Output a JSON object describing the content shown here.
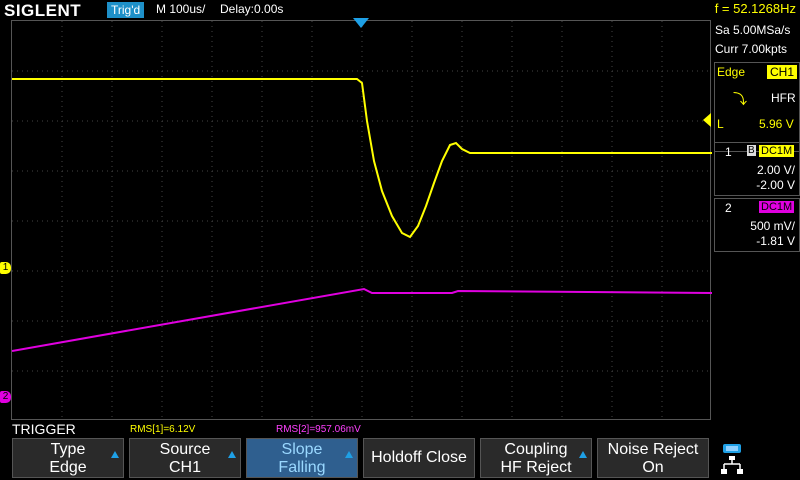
{
  "header": {
    "logo": "SIGLENT",
    "trigger_status": "Trig'd",
    "timebase": "M 100us/",
    "delay": "Delay:0.00s",
    "frequency": "f = 52.1268Hz"
  },
  "panel": {
    "sample_rate": "Sa 5.00MSa/s",
    "memory": "Curr 7.00kpts",
    "trigger": {
      "type": "Edge",
      "source": "CH1",
      "coupling": "HFR",
      "level_label": "L",
      "level": "5.96 V"
    },
    "ch1": {
      "number": "1",
      "coupling_tag": "DC1M",
      "bw": "B",
      "scale": "2.00 V/",
      "offset": "-2.00 V"
    },
    "ch2": {
      "number": "2",
      "coupling_tag": "DC1M",
      "scale": "500 mV/",
      "offset": "-1.81 V"
    }
  },
  "markers": {
    "ch1": "1",
    "ch2": "2"
  },
  "bottom": {
    "menu_title": "TRIGGER",
    "rms1": "RMS[1]=6.12V",
    "rms2": "RMS[2]=957.06mV",
    "softkeys": [
      {
        "l1": "Type",
        "l2": "Edge"
      },
      {
        "l1": "Source",
        "l2": "CH1"
      },
      {
        "l1": "Slope",
        "l2": "Falling"
      },
      {
        "l1": "Holdoff Close"
      },
      {
        "l1": "Coupling",
        "l2": "HF Reject"
      },
      {
        "l1": "Noise Reject",
        "l2": "On"
      }
    ]
  },
  "colors": {
    "ch1": "#ffff00",
    "ch2": "#e000e0",
    "accent": "#1ea0e6"
  }
}
